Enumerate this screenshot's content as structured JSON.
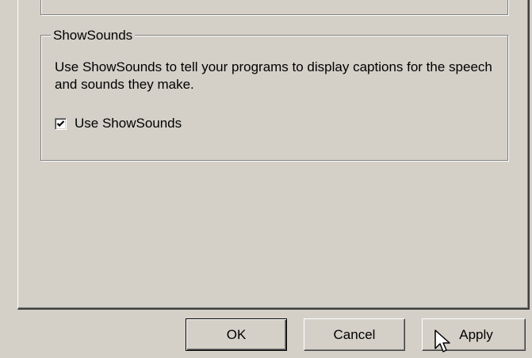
{
  "group": {
    "legend": "ShowSounds",
    "description": "Use ShowSounds to tell your programs to display captions for the speech and sounds they make.",
    "checkbox_label": "Use ShowSounds",
    "checkbox_checked": true
  },
  "buttons": {
    "ok": "OK",
    "cancel": "Cancel",
    "apply": "Apply"
  },
  "cursor": {
    "icon": "arrow-pointer-icon"
  },
  "colors": {
    "face": "#d4d0c8",
    "shadow": "#808080",
    "highlight": "#ffffff"
  }
}
